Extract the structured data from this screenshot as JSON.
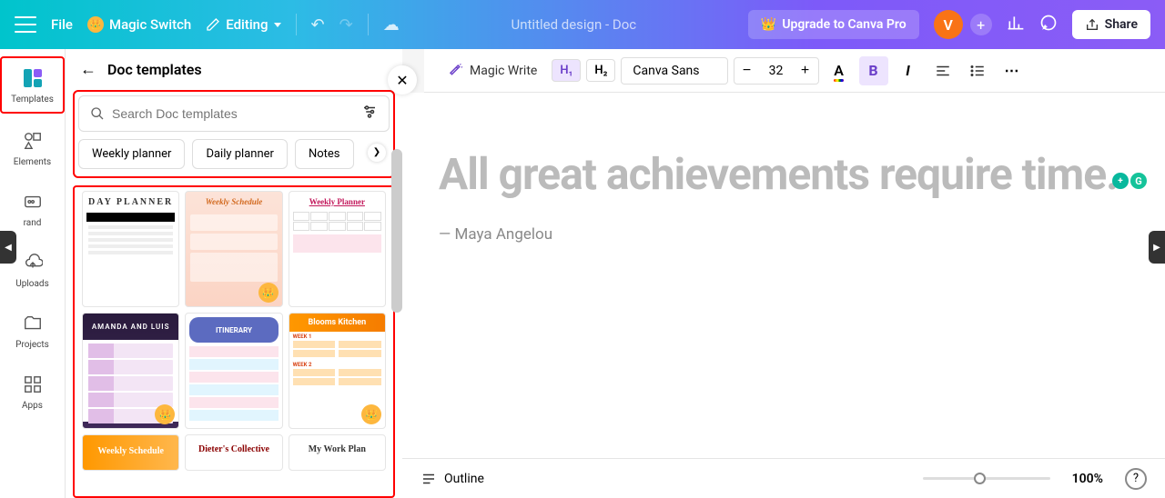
{
  "topbar": {
    "file": "File",
    "magic_switch": "Magic Switch",
    "editing": "Editing",
    "doc_title": "Untitled design - Doc",
    "upgrade": "Upgrade to Canva Pro",
    "avatar_initial": "V",
    "share": "Share"
  },
  "rail": {
    "templates": "Templates",
    "elements": "Elements",
    "brand": "rand",
    "uploads": "Uploads",
    "projects": "Projects",
    "apps": "Apps"
  },
  "panel": {
    "title": "Doc templates",
    "search_placeholder": "Search Doc templates",
    "chips": [
      "Weekly planner",
      "Daily planner",
      "Notes"
    ],
    "templates": {
      "r1": [
        "DAY PLANNER",
        "Weekly Schedule",
        "Weekly Planner"
      ],
      "r2": [
        "AMANDA AND LUIS",
        "ITINERARY",
        "Blooms Kitchen"
      ],
      "r3": [
        "Weekly Schedule",
        "Dieter's Collective",
        "My Work Plan"
      ]
    }
  },
  "editor": {
    "magic_write": "Magic Write",
    "h1": "H₁",
    "h2": "H₂",
    "font": "Canva Sans",
    "size": "32"
  },
  "doc": {
    "quote": "All great achievements require time.",
    "author": "— Maya Angelou"
  },
  "bottom": {
    "outline": "Outline",
    "zoom": "100%"
  }
}
